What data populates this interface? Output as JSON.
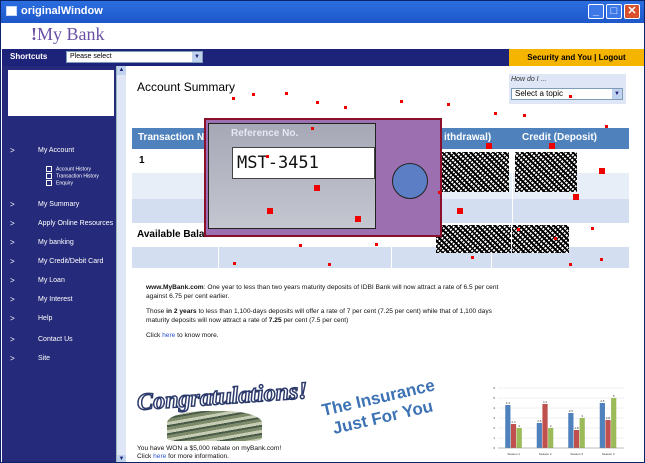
{
  "window": {
    "title": "originalWindow",
    "buttons": [
      "_",
      "□",
      "✕"
    ]
  },
  "brand": {
    "logo_mark": "!",
    "logo_text": "My Bank"
  },
  "navbar": {
    "shortcuts_label": "Shortcuts",
    "shortcuts_select": "Please select",
    "security_link": "Security and You",
    "separator": "|",
    "logout_link": "Logout"
  },
  "sidebar": {
    "items": [
      {
        "label": "My Account"
      },
      {
        "label": "My Summary"
      },
      {
        "label": "Apply Online Resources"
      },
      {
        "label": "My banking"
      },
      {
        "label": "My Credit/Debit Card"
      },
      {
        "label": "My Loan"
      },
      {
        "label": "My Interest"
      },
      {
        "label": "Help"
      },
      {
        "label": "Contact Us"
      },
      {
        "label": "Site"
      }
    ],
    "subitems": [
      "Account History",
      "Transaction History",
      "Enquiry"
    ]
  },
  "main": {
    "title": "Account Summary",
    "howdo": {
      "question": "How do I ...",
      "select": "Select a topic"
    },
    "table": {
      "col1": "Transaction N",
      "col3": "ithdrawal)",
      "col4": "Credit (Deposit)",
      "row1_value": "1",
      "balance_label": "Available Bala"
    }
  },
  "overlay": {
    "label": "Reference No.",
    "value": "MST-3451"
  },
  "promo": {
    "site": "www.MyBank.com",
    "p1_rest": ": One year to less than two years maturity deposits of IDBI Bank will now attract a rate of 6.5 per cent against 6.75 per cent earlier.",
    "p2_a": "Those ",
    "p2_b": "in 2 years",
    "p2_c": " to less than 1,100-days deposits will offer a rate of 7 per cent (7.25 per cent) while that of 1,100 days maturity deposits will now attract a rate of ",
    "p2_d": "7.25",
    "p2_e": " per cent (7.5 per cent)",
    "click_a": "Click ",
    "click_link": "here",
    "click_b": " to know more."
  },
  "banners": {
    "congrats": "Congratulations!",
    "won_a": "You have WON a $5,000 rebate on myBank.com!",
    "won_click": "Click ",
    "won_link": "here",
    "won_rest": " for more information.",
    "insurance_line1": "The Insurance",
    "insurance_line2": "Just For You"
  },
  "chart_data": {
    "type": "bar",
    "categories": [
      "Season 1",
      "Season 2",
      "Season 3",
      "Season 4"
    ],
    "series": [
      {
        "values": [
          4.3,
          2.5,
          3.5,
          4.5
        ]
      },
      {
        "values": [
          2.4,
          4.4,
          1.8,
          2.8
        ]
      },
      {
        "values": [
          2,
          2,
          3,
          5
        ]
      }
    ],
    "ylim": [
      0,
      6
    ],
    "colors": [
      "#4f81bd",
      "#c0504d",
      "#9bbb59"
    ]
  }
}
